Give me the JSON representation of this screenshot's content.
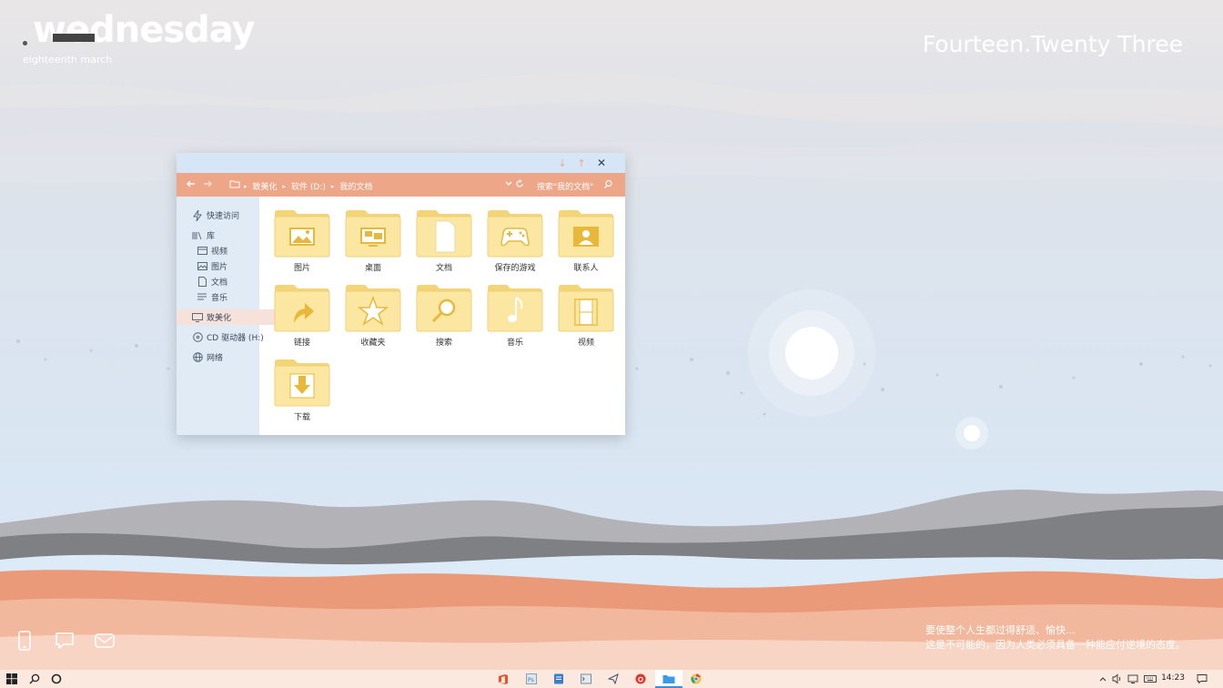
{
  "desktop": {
    "day": "wednesday",
    "date": "eighteenth march",
    "time_words": "Fourteen.Twenty Three",
    "quote_line1": "要使整个人生都过得舒适、愉快...",
    "quote_line2": "这是不可能的，因为人类必须具备一种能应付逆境的态度。"
  },
  "desktop_widgets": [
    "phone-icon",
    "chat-icon",
    "mail-icon"
  ],
  "explorer": {
    "breadcrumb": [
      "致美化",
      "软件 (D:)",
      "我的文档"
    ],
    "search_placeholder": "搜索\"我的文档\"",
    "sidebar": {
      "quick_access": "快速访问",
      "library": "库",
      "videos": "视频",
      "pictures": "图片",
      "documents": "文档",
      "music": "音乐",
      "zhimeihua": "致美化",
      "cd_drive": "CD 驱动器 (H:)",
      "network": "网络"
    },
    "folders": [
      {
        "label": "图片",
        "icon": "picture-icon"
      },
      {
        "label": "桌面",
        "icon": "desktop-icon"
      },
      {
        "label": "文档",
        "icon": "document-icon"
      },
      {
        "label": "保存的游戏",
        "icon": "gamepad-icon"
      },
      {
        "label": "联系人",
        "icon": "contact-icon"
      },
      {
        "label": "链接",
        "icon": "link-arrow-icon"
      },
      {
        "label": "收藏夹",
        "icon": "star-icon"
      },
      {
        "label": "搜索",
        "icon": "search-icon"
      },
      {
        "label": "音乐",
        "icon": "music-note-icon"
      },
      {
        "label": "视频",
        "icon": "film-icon"
      },
      {
        "label": "下载",
        "icon": "download-arrow-icon"
      }
    ]
  },
  "taskbar": {
    "clock": "14:23"
  },
  "colors": {
    "nav_accent": "#eea689",
    "titlebar": "#d6e6f6",
    "sidebar": "#e0ebf6",
    "folder_body": "#fbe7a1",
    "folder_tab": "#f3d477",
    "folder_glyph": "#e8b83a"
  }
}
